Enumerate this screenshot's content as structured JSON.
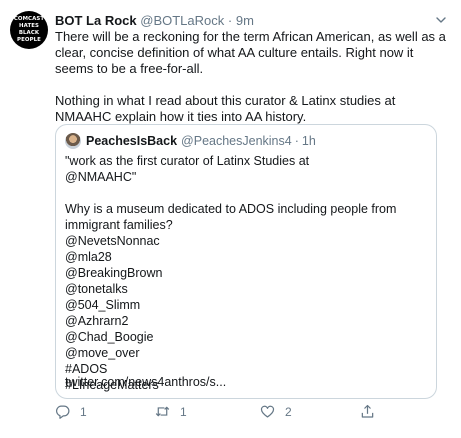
{
  "tweet": {
    "avatar_text": [
      "COMCAST",
      "HATES",
      "BLACK",
      "PEOPLE"
    ],
    "display_name": "BOT La Rock",
    "handle": "@BOTLaRock",
    "separator": "·",
    "age": "9m",
    "paragraph1": "There will be a reckoning for the term African American, as well as a clear, concise definition of what AA culture entails. Right now it seems to be a free-for-all.",
    "paragraph2": "Nothing in what I read about this curator & Latinx studies at NMAAHC explain how it ties into AA history."
  },
  "quoted": {
    "display_name": "PeachesIsBack",
    "handle": "@PeachesJenkins4",
    "separator": "·",
    "age": "1h",
    "lines": [
      "\"work as the first curator of Latinx Studies at",
      "@NMAAHC\"",
      "Why is a museum dedicated to ADOS including people from",
      "immigrant families?",
      "@NevetsNonnac",
      "@mla28",
      "@BreakingBrown",
      "@tonetalks",
      "@504_Slimm",
      "@Azhrarn2",
      "@Chad_Boogie",
      "@move_over",
      "#ADOS",
      "#LIneageMatters"
    ],
    "link": "twitter.com/news4anthros/s..."
  },
  "actions": {
    "reply_count": "1",
    "retweet_count": "1",
    "like_count": "2"
  },
  "colors": {
    "text": "#14171a",
    "secondary": "#657786",
    "border": "#ccd6dd"
  },
  "icons": [
    "caret-down-icon",
    "reply-icon",
    "retweet-icon",
    "heart-icon",
    "share-icon"
  ]
}
